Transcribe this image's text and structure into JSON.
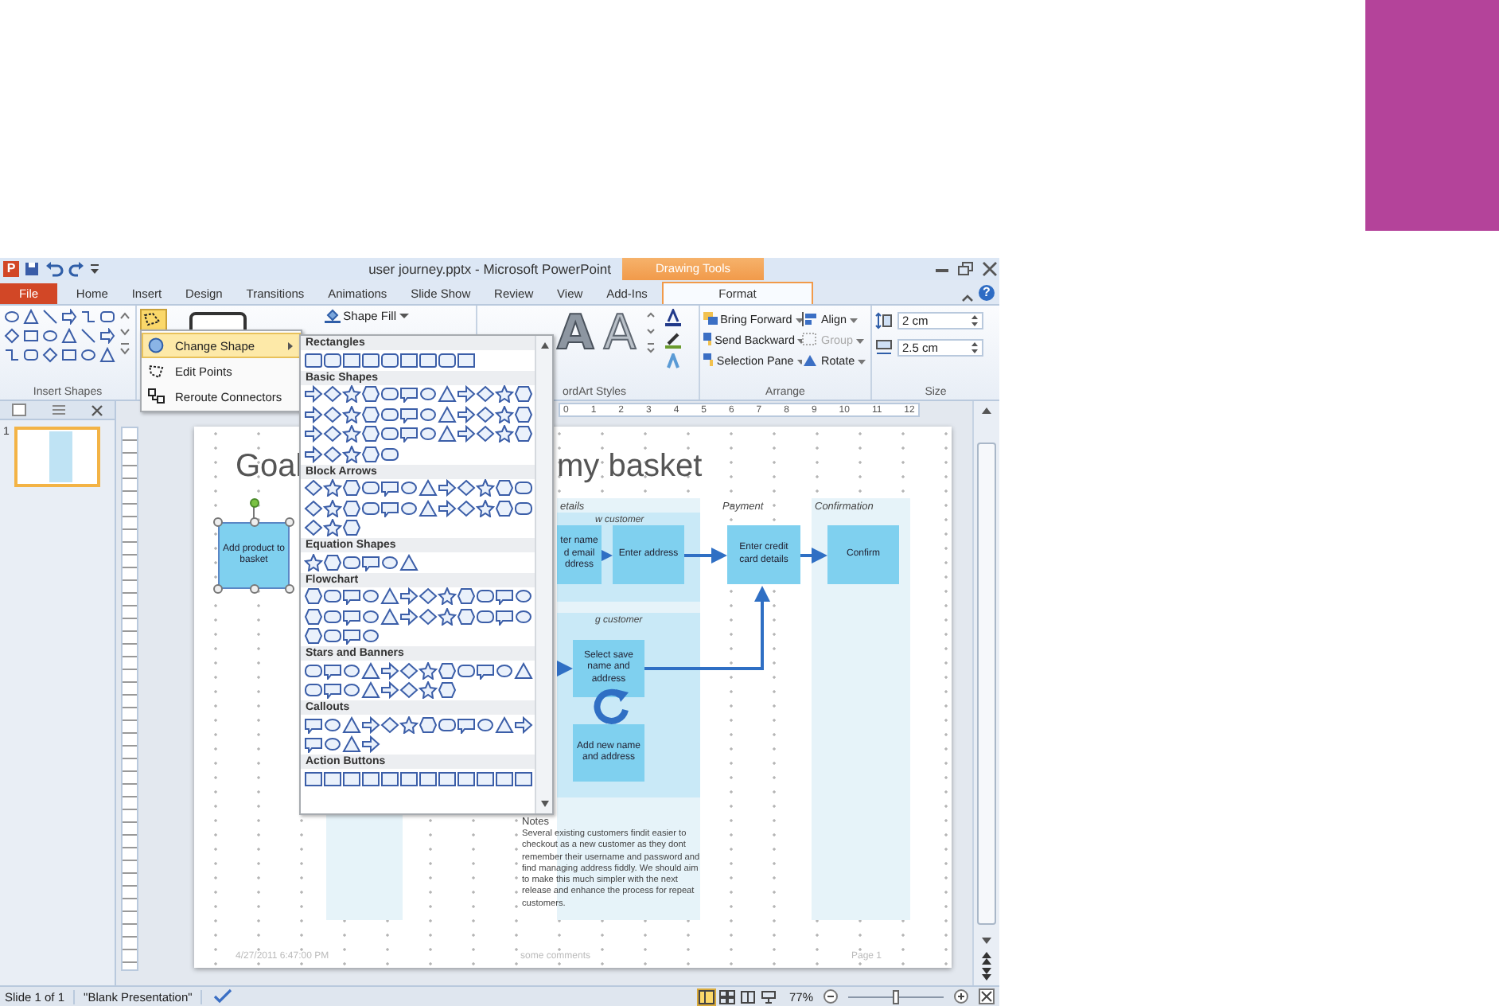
{
  "window": {
    "app_icon": "P",
    "title": "user journey.pptx - Microsoft PowerPoint",
    "context_label": "Drawing Tools",
    "help": "?"
  },
  "tabs": [
    {
      "label": "File",
      "kind": "file",
      "selected": false
    },
    {
      "label": "Home",
      "kind": "main",
      "selected": false
    },
    {
      "label": "Insert",
      "kind": "main",
      "selected": false
    },
    {
      "label": "Design",
      "kind": "main",
      "selected": false
    },
    {
      "label": "Transitions",
      "kind": "main",
      "selected": false
    },
    {
      "label": "Animations",
      "kind": "main",
      "selected": false
    },
    {
      "label": "Slide Show",
      "kind": "main",
      "selected": false
    },
    {
      "label": "Review",
      "kind": "main",
      "selected": false
    },
    {
      "label": "View",
      "kind": "main",
      "selected": false
    },
    {
      "label": "Add-Ins",
      "kind": "main",
      "selected": false
    },
    {
      "label": "Format",
      "kind": "contextual",
      "selected": true
    }
  ],
  "ribbon": {
    "insert_shapes": {
      "label": "Insert Shapes"
    },
    "shape_styles": {
      "fill": "Shape Fill"
    },
    "wordart": {
      "samples": [
        "A",
        "A"
      ],
      "label": "ordArt Styles"
    },
    "arrange": {
      "label": "Arrange",
      "items": [
        {
          "label": "Bring Forward",
          "kind": "forward",
          "disabled": false
        },
        {
          "label": "Send Backward",
          "kind": "backward",
          "disabled": false
        },
        {
          "label": "Selection Pane",
          "kind": "pane",
          "disabled": false
        },
        {
          "label": "Align",
          "kind": "align",
          "disabled": false
        },
        {
          "label": "Group",
          "kind": "group",
          "disabled": true
        },
        {
          "label": "Rotate",
          "kind": "rotate",
          "disabled": false
        }
      ]
    },
    "size": {
      "label": "Size",
      "fields": [
        {
          "kind": "height",
          "value": "2 cm"
        },
        {
          "kind": "width",
          "value": "2.5 cm"
        }
      ]
    }
  },
  "shape_menu": {
    "items": [
      {
        "label": "Change Shape",
        "kind": "change",
        "selected": true
      },
      {
        "label": "Edit Points",
        "kind": "points",
        "selected": false
      },
      {
        "label": "Reroute Connectors",
        "kind": "reroute",
        "selected": false
      }
    ]
  },
  "gallery": {
    "sections": [
      {
        "title": "Rectangles"
      },
      {
        "title": "Basic Shapes"
      },
      {
        "title": "Block Arrows"
      },
      {
        "title": "Equation Shapes"
      },
      {
        "title": "Flowchart"
      },
      {
        "title": "Stars and Banners"
      },
      {
        "title": "Callouts"
      },
      {
        "title": "Action Buttons"
      }
    ]
  },
  "slides_pane": {
    "thumbnails": [
      {
        "number": "1",
        "selected": true
      }
    ]
  },
  "ruler": {
    "labels": [
      "0",
      "1",
      "2",
      "3",
      "4",
      "5",
      "6",
      "7",
      "8",
      "9",
      "10",
      "11",
      "12"
    ]
  },
  "slide": {
    "title_parts": [
      "Goal",
      "my basket"
    ],
    "lanes": [
      {
        "kind": "shaded"
      },
      {
        "kind": "shaded",
        "label": "etails"
      },
      {
        "kind": "plain",
        "label": "Payment"
      },
      {
        "kind": "shaded",
        "label": "Confirmation"
      }
    ],
    "groups": [
      {
        "label": "w customer"
      },
      {
        "label": "g customer"
      }
    ],
    "nodes": [
      {
        "text": "Add product to basket",
        "selected": true
      },
      {
        "text": "ter name\nd email\nddress",
        "selected": false
      },
      {
        "text": "Enter address",
        "selected": false
      },
      {
        "text": "Enter credit card details",
        "selected": false
      },
      {
        "text": "Confirm",
        "selected": false
      },
      {
        "text": "Select save name and address",
        "selected": false
      },
      {
        "text": "Add new name and address",
        "selected": false
      }
    ],
    "notes": {
      "title": "Notes",
      "body": "Several existing customers findit easier to checkout as a new customer as they dont remember their username and password and find managing address fiddly. We should aim to make this much simpler with the next release and enhance the process for repeat customers."
    },
    "footer": [
      "4/27/2011 6:47:00 PM",
      "some comments",
      "Page 1"
    ]
  },
  "status_bar": {
    "slide": "Slide 1 of 1",
    "theme": "\"Blank Presentation\"",
    "views": [
      {
        "kind": "normal",
        "selected": true
      },
      {
        "kind": "sorter",
        "selected": false
      },
      {
        "kind": "reading",
        "selected": false
      },
      {
        "kind": "show",
        "selected": false
      }
    ],
    "zoom": "77%",
    "zoom_slider": {
      "level": 0.5
    }
  }
}
